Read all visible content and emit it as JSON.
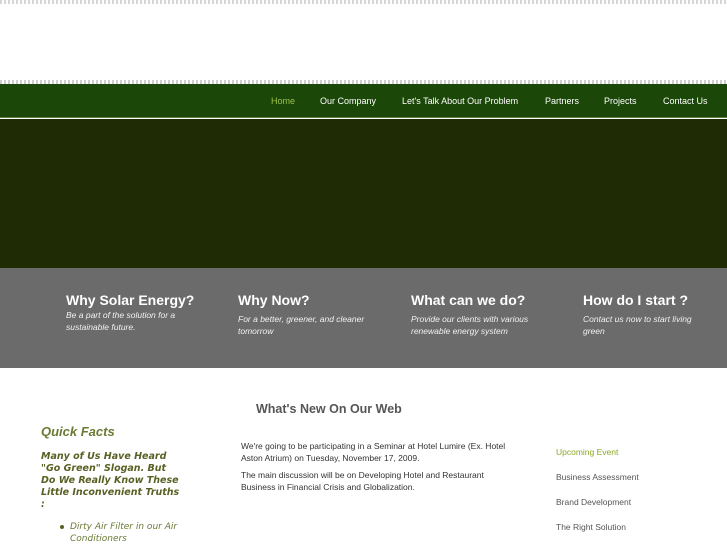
{
  "nav": {
    "items": [
      {
        "label": "Home",
        "active": true
      },
      {
        "label": "Our Company"
      },
      {
        "label": "Let's Talk About Our Problem"
      },
      {
        "label": "Partners"
      },
      {
        "label": "Projects"
      },
      {
        "label": "Contact Us"
      }
    ]
  },
  "features": [
    {
      "title": "Why Solar Energy?",
      "desc": "Be a part of the solution for a sustainable future."
    },
    {
      "title": "Why Now?",
      "desc": "For a better, greener, and cleaner tomorrow"
    },
    {
      "title": "What can we do?",
      "desc": "Provide our clients with various renewable energy system"
    },
    {
      "title": "How do I start ?",
      "desc": "Contact us now to start living green"
    }
  ],
  "main": {
    "heading": "What's New On Our Web"
  },
  "quick_facts": {
    "title": "Quick Facts",
    "subtitle": "Many of Us Have Heard \"Go Green\" Slogan. But Do We Really Know These Little Inconvenient Truths :",
    "items": [
      "Dirty Air Filter in our Air Conditioners"
    ]
  },
  "news": {
    "paragraphs": [
      "We're going to be participating in a Seminar at Hotel Lumire (Ex. Hotel Aston Atrium) on Tuesday, November 17, 2009.",
      "The main discussion will be on Developing Hotel and Restaurant Business in Financial Crisis and Globalization."
    ]
  },
  "sidebar": {
    "links": [
      {
        "label": "Upcoming Event",
        "active": true
      },
      {
        "label": "Business Assessment"
      },
      {
        "label": "Brand Development"
      },
      {
        "label": "The Right Solution"
      }
    ]
  },
  "colors": {
    "nav_bg": "#1b4708",
    "nav_active": "#9cc24a",
    "hero_bg": "#1e2b04",
    "features_bg": "#6b6b6b",
    "accent_green": "#8aa824"
  }
}
